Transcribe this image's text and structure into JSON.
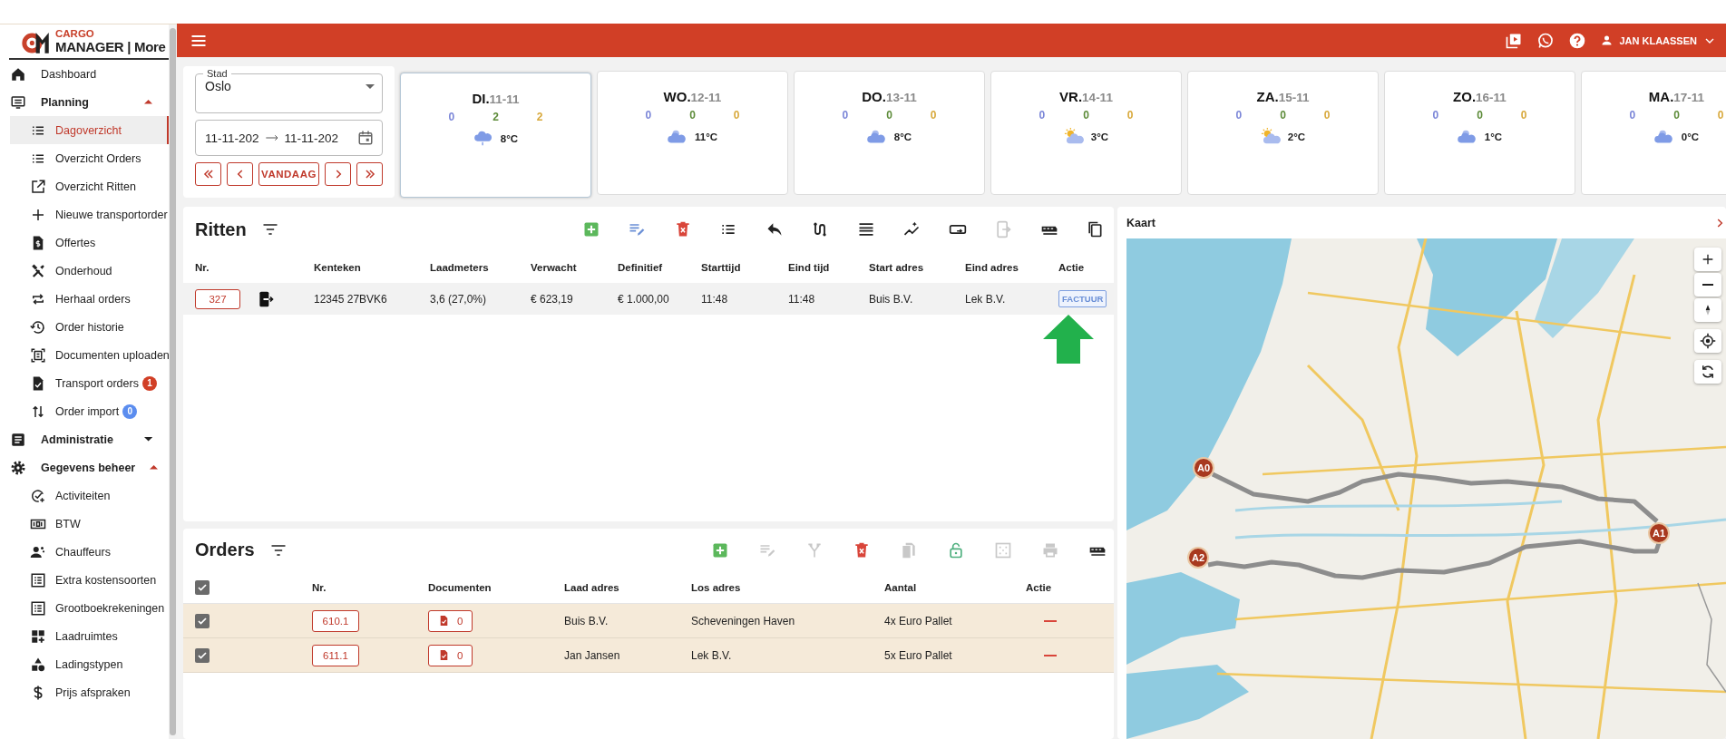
{
  "sidebar": {
    "logo": {
      "brand_top": "CARGO",
      "brand_bottom": "MANAGER | More"
    },
    "items": [
      {
        "kind": "home",
        "label": "Dashboard",
        "selected": false
      },
      {
        "kind": "monitor",
        "label": "Planning",
        "selected": false,
        "expanded": true,
        "children": [
          {
            "kind": "list",
            "label": "Dagoverzicht",
            "selected": true
          },
          {
            "kind": "list",
            "label": "Overzicht Orders",
            "selected": false
          },
          {
            "kind": "external",
            "label": "Overzicht Ritten",
            "selected": false
          },
          {
            "kind": "plus",
            "label": "Nieuwe transportorder",
            "selected": false
          },
          {
            "kind": "doc-dollar",
            "label": "Offertes",
            "selected": false
          },
          {
            "kind": "tools",
            "label": "Onderhoud",
            "selected": false
          },
          {
            "kind": "repeat",
            "label": "Herhaal orders",
            "selected": false
          },
          {
            "kind": "history",
            "label": "Order historie",
            "selected": false
          },
          {
            "kind": "scan",
            "label": "Documenten uploaden",
            "selected": false
          },
          {
            "kind": "doc-check",
            "label": "Transport orders",
            "selected": false,
            "badge": {
              "text": "1",
              "color": "#d13f26"
            }
          },
          {
            "kind": "swap",
            "label": "Order import",
            "selected": false,
            "badge": {
              "text": "0",
              "color": "#5b8def"
            }
          }
        ]
      },
      {
        "kind": "article",
        "label": "Administratie",
        "selected": false,
        "expanded": false
      },
      {
        "kind": "gear",
        "label": "Gegevens beheer",
        "selected": false,
        "expanded": true,
        "children": [
          {
            "kind": "check-circle",
            "label": "Activiteiten",
            "selected": false
          },
          {
            "kind": "counter",
            "label": "BTW",
            "selected": false
          },
          {
            "kind": "people",
            "label": "Chauffeurs",
            "selected": false
          },
          {
            "kind": "list-box",
            "label": "Extra kostensoorten",
            "selected": false
          },
          {
            "kind": "list-box",
            "label": "Grootboekrekeningen",
            "selected": false
          },
          {
            "kind": "grid",
            "label": "Laadruimtes",
            "selected": false
          },
          {
            "kind": "shapes",
            "label": "Ladingstypen",
            "selected": false
          },
          {
            "kind": "dollar",
            "label": "Prijs afspraken",
            "selected": false
          }
        ]
      }
    ]
  },
  "header": {
    "user": "JAN KLAASSEN"
  },
  "filters": {
    "city": {
      "label": "Stad",
      "value": "Oslo"
    },
    "date_from": "11-11-202",
    "date_to": "11-11-202",
    "today_button": "VANDAAG"
  },
  "days": [
    {
      "day": "DI.",
      "date": "11-11",
      "selected": true,
      "counts": [
        {
          "value": "0",
          "color": "#7b86d8"
        },
        {
          "value": "2",
          "color": "#5e8c3a"
        },
        {
          "value": "2",
          "color": "#d8a93c"
        }
      ],
      "kind": "rain",
      "temperature": "8°C"
    },
    {
      "day": "WO.",
      "date": "12-11",
      "selected": false,
      "counts": [
        {
          "value": "0",
          "color": "#7b86d8"
        },
        {
          "value": "0",
          "color": "#5e8c3a"
        },
        {
          "value": "0",
          "color": "#d8a93c"
        }
      ],
      "kind": "cloudy",
      "temperature": "11°C"
    },
    {
      "day": "DO.",
      "date": "13-11",
      "selected": false,
      "counts": [
        {
          "value": "0",
          "color": "#7b86d8"
        },
        {
          "value": "0",
          "color": "#5e8c3a"
        },
        {
          "value": "0",
          "color": "#d8a93c"
        }
      ],
      "kind": "cloudy",
      "temperature": "8°C"
    },
    {
      "day": "VR.",
      "date": "14-11",
      "selected": false,
      "counts": [
        {
          "value": "0",
          "color": "#7b86d8"
        },
        {
          "value": "0",
          "color": "#5e8c3a"
        },
        {
          "value": "0",
          "color": "#d8a93c"
        }
      ],
      "kind": "partly-sunny",
      "temperature": "3°C"
    },
    {
      "day": "ZA.",
      "date": "15-11",
      "selected": false,
      "counts": [
        {
          "value": "0",
          "color": "#7b86d8"
        },
        {
          "value": "0",
          "color": "#5e8c3a"
        },
        {
          "value": "0",
          "color": "#d8a93c"
        }
      ],
      "kind": "partly-sunny",
      "temperature": "2°C"
    },
    {
      "day": "ZO.",
      "date": "16-11",
      "selected": false,
      "counts": [
        {
          "value": "0",
          "color": "#7b86d8"
        },
        {
          "value": "0",
          "color": "#5e8c3a"
        },
        {
          "value": "0",
          "color": "#d8a93c"
        }
      ],
      "kind": "cloudy",
      "temperature": "1°C"
    },
    {
      "day": "MA.",
      "date": "17-11",
      "selected": false,
      "counts": [
        {
          "value": "0",
          "color": "#7b86d8"
        },
        {
          "value": "0",
          "color": "#5e8c3a"
        },
        {
          "value": "0",
          "color": "#d8a93c"
        }
      ],
      "kind": "cloudy",
      "temperature": "0°C"
    }
  ],
  "ritten": {
    "title": "Ritten",
    "toolbar": [
      {
        "kind": "add",
        "disabled": false
      },
      {
        "kind": "edit",
        "disabled": false
      },
      {
        "kind": "delete",
        "disabled": false
      },
      {
        "kind": "list",
        "disabled": false
      },
      {
        "kind": "reply",
        "disabled": false
      },
      {
        "kind": "route",
        "disabled": false
      },
      {
        "kind": "lines",
        "disabled": false
      },
      {
        "kind": "trend",
        "disabled": false
      },
      {
        "kind": "card",
        "disabled": false
      },
      {
        "kind": "exit",
        "disabled": true
      },
      {
        "kind": "vehicle",
        "disabled": false
      },
      {
        "kind": "copy",
        "disabled": false
      }
    ],
    "columns": [
      "Nr.",
      "Kenteken",
      "Laadmeters",
      "Verwacht",
      "Definitief",
      "Starttijd",
      "Eind tijd",
      "Start adres",
      "Eind adres",
      "Actie"
    ],
    "rows": [
      {
        "cells": [
          "327",
          "12345 27BVK6",
          "3,6 (27,0%)",
          "€ 623,19",
          "€ 1.000,00",
          "11:48",
          "11:48",
          "Buis B.V.",
          "Lek B.V."
        ],
        "action": "FACTUUR"
      }
    ]
  },
  "orders": {
    "title": "Orders",
    "toolbar": [
      {
        "kind": "add",
        "disabled": false
      },
      {
        "kind": "edit",
        "disabled": true
      },
      {
        "kind": "merge",
        "disabled": true
      },
      {
        "kind": "delete",
        "disabled": false
      },
      {
        "kind": "docs",
        "disabled": true
      },
      {
        "kind": "lock",
        "disabled": false
      },
      {
        "kind": "gridbox",
        "disabled": true
      },
      {
        "kind": "print",
        "disabled": true
      },
      {
        "kind": "vehicle",
        "disabled": false
      }
    ],
    "columns": [
      {
        "kind": "checkbox",
        "checked": true
      },
      {
        "kind": "text",
        "label": "Nr."
      },
      {
        "kind": "text",
        "label": "Documenten"
      },
      {
        "kind": "text",
        "label": "Laad adres"
      },
      {
        "kind": "text",
        "label": "Los adres"
      },
      {
        "kind": "text",
        "label": "Aantal"
      },
      {
        "kind": "text",
        "label": "Actie"
      }
    ],
    "rows": [
      {
        "checked": true,
        "nr": "610.1",
        "documents": "0",
        "cells": [
          "Buis B.V.",
          "Scheveningen Haven",
          "4x Euro Pallet"
        ]
      },
      {
        "checked": true,
        "nr": "611.1",
        "documents": "0",
        "cells": [
          "Jan Jansen",
          "Lek B.V.",
          "5x Euro Pallet"
        ]
      }
    ]
  },
  "map": {
    "title": "Kaart",
    "markers": [
      {
        "label": "A0"
      },
      {
        "label": "A1"
      },
      {
        "label": "A2"
      }
    ]
  }
}
